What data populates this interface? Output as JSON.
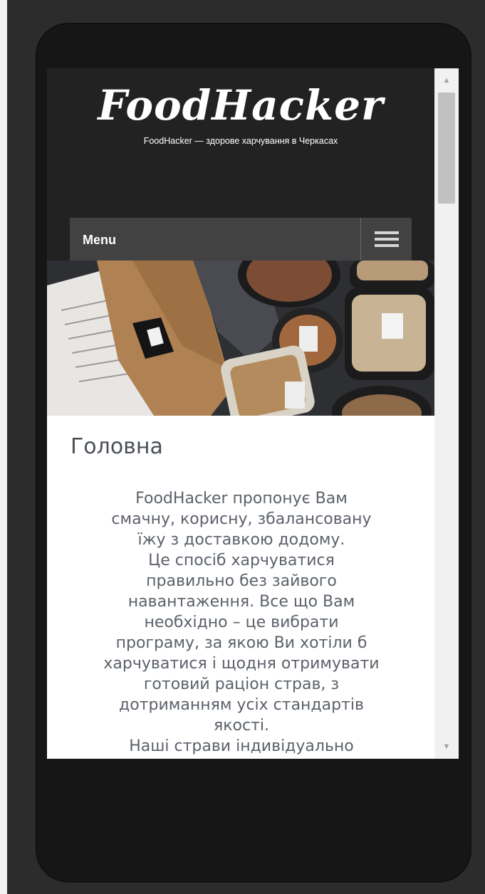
{
  "site": {
    "logo": "FoodHacker",
    "tagline": "FoodHacker — здорове харчування в Черкасах"
  },
  "menu": {
    "label": "Menu",
    "toggle_icon": "hamburger-icon"
  },
  "content": {
    "title": "Головна",
    "lines": [
      "FoodHacker пропонує Вам",
      "смачну, корисну, збалансовану",
      "їжу з доставкою додому.",
      "Це спосіб харчуватися",
      "правильно без зайвого",
      "навантаження. Все що Вам",
      "необхідно – це вибрати",
      "програму, за якою Ви хотіли б",
      "харчуватися і щодня отримувати",
      "готовий раціон страв, з",
      "дотриманням усіх стандартів",
      "якості.",
      "Наші страви індивідуально"
    ]
  },
  "scrollbar": {
    "up_icon": "scroll-up-arrow-icon",
    "down_icon": "scroll-down-arrow-icon"
  }
}
